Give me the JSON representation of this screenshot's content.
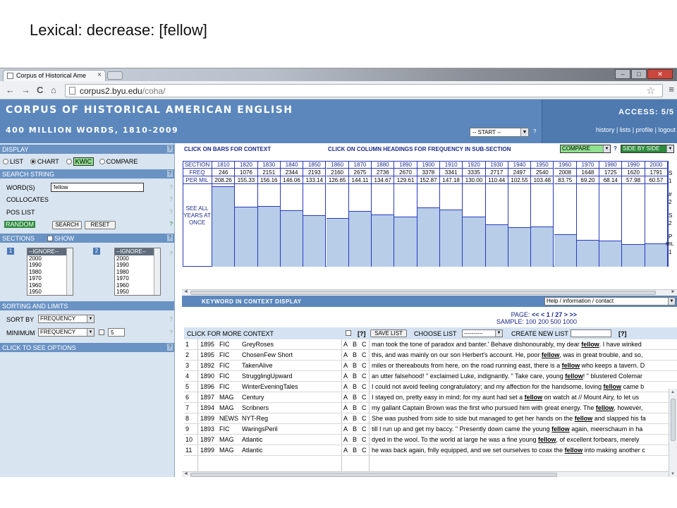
{
  "slide": {
    "title": "Lexical: decrease: [fellow]"
  },
  "browser": {
    "tab_title": "Corpus of Historical Ame",
    "tab_close": "×",
    "url_host": "corpus2.byu.edu",
    "url_path": "/coha/",
    "back": "←",
    "forward": "→",
    "reload": "C",
    "home": "⌂",
    "star": "☆",
    "menu": "≡",
    "min": "–",
    "max": "□",
    "close": "✕"
  },
  "header": {
    "title": "CORPUS OF HISTORICAL AMERICAN ENGLISH",
    "subtitle": "400 MILLION WORDS, 1810-2009",
    "start_select": "-- START --",
    "start_help": "?",
    "access": "ACCESS:  5/5",
    "links": "history  |  lists  |  profile  |  logout"
  },
  "left": {
    "display_head": "DISPLAY",
    "display_options": {
      "list": "LIST",
      "chart": "CHART",
      "kwic": "KWIC",
      "compare": "COMPARE"
    },
    "search_head": "SEARCH STRING",
    "words_label": "WORD(S)",
    "words_value": "fellow",
    "collocates_label": "COLLOCATES",
    "poslist_label": "POS LIST",
    "random_label": "RANDOM",
    "search_btn": "SEARCH",
    "reset_btn": "RESET",
    "sections_head": "SECTIONS",
    "show_label": "SHOW",
    "sec1_num": "1",
    "sec2_num": "2",
    "sec1_options": [
      "--IGNORE--",
      "2000",
      "1990",
      "1980",
      "1970",
      "1960",
      "1950"
    ],
    "sec2_options": [
      "--IGNORE--",
      "2000",
      "1990",
      "1980",
      "1970",
      "1960",
      "1950"
    ],
    "sorting_head": "SORTING AND LIMITS",
    "sort_by_label": "SORT BY",
    "sort_by_value": "FREQUENCY",
    "minimum_label": "MINIMUM",
    "minimum_value": "FREQUENCY",
    "minimum_num": "5",
    "options_head": "CLICK TO SEE OPTIONS",
    "q": "?"
  },
  "chart": {
    "click_bars": "CLICK ON BARS FOR CONTEXT",
    "click_cols": "CLICK ON COLUMN HEADINGS FOR FREQUENCY IN SUB-SECTION",
    "compare_select": "COMPARE",
    "help": "?",
    "side_select": "SIDE BY SIDE",
    "section_label": "SECTION",
    "freq_label": "FREQ",
    "permil_label": "PER MIL",
    "see_all": "SEE ALL YEARS AT ONCE",
    "side_letters": [
      "S",
      "1",
      "#",
      "2",
      "S",
      "2",
      "P",
      "MIL",
      "1"
    ]
  },
  "chart_data": {
    "type": "bar",
    "categories": [
      "1810",
      "1820",
      "1830",
      "1840",
      "1850",
      "1860",
      "1870",
      "1880",
      "1890",
      "1900",
      "1910",
      "1920",
      "1930",
      "1940",
      "1950",
      "1960",
      "1970",
      "1980",
      "1990",
      "2000"
    ],
    "freq": [
      246,
      1076,
      2151,
      2344,
      2193,
      2160,
      2675,
      2736,
      2670,
      3378,
      3341,
      3335,
      2717,
      2497,
      2540,
      2008,
      1648,
      1725,
      1620,
      1791
    ],
    "values": [
      208.26,
      155.33,
      156.16,
      146.06,
      133.14,
      126.65,
      144.11,
      134.67,
      129.61,
      152.87,
      147.18,
      130.0,
      110.44,
      102.55,
      103.48,
      83.75,
      69.2,
      68.14,
      57.98,
      60.57
    ],
    "values_display": [
      "208.26",
      "155.33",
      "156.16",
      "146.06",
      "133.14",
      "126.65",
      "144.11",
      "134.67",
      "129.61",
      "152.87",
      "147.18",
      "130.00",
      "110.44",
      "102.55",
      "103.48",
      "83.75",
      "69.20",
      "68.14",
      "57.98",
      "60.57"
    ],
    "ylabel": "PER MIL"
  },
  "kwic": {
    "title": "KEYWORD IN CONTEXT DISPLAY",
    "help_select": "Help / information / contact",
    "page_label": "PAGE:",
    "page_nav": "<<  <   1 / 27  >   >>",
    "sample_label": "SAMPLE: 100  200  500  1000",
    "more_context": "CLICK FOR MORE CONTEXT",
    "q": "[?]",
    "save_list": "SAVE LIST",
    "choose_list": "CHOOSE LIST",
    "choose_value": "----------",
    "create_list": "CREATE NEW LIST",
    "q2": "[?]",
    "rows": [
      {
        "n": "1",
        "year": "1895",
        "genre": "FIC",
        "source": "GreyRoses",
        "a": "A",
        "b": "B",
        "c": "C",
        "pre": "man took the tone of paradox and banter.' Behave dishonourably, my dear ",
        "kw": "fellow",
        "post": ". I have winked"
      },
      {
        "n": "2",
        "year": "1895",
        "genre": "FIC",
        "source": "ChosenFew Short",
        "a": "A",
        "b": "B",
        "c": "C",
        "pre": "this, and was mainly on our son Herbert's account. He, poor ",
        "kw": "fellow",
        "post": ", was in great trouble, and so,"
      },
      {
        "n": "3",
        "year": "1892",
        "genre": "FIC",
        "source": "TakenAlive",
        "a": "A",
        "b": "B",
        "c": "C",
        "pre": "miles or thereabouts from here, on the road running east, there is a ",
        "kw": "fellow",
        "post": " who keeps a tavern. D"
      },
      {
        "n": "4",
        "year": "1890",
        "genre": "FIC",
        "source": "StrugglingUpward",
        "a": "A",
        "b": "B",
        "c": "C",
        "pre": "an utter falsehood! \" exclaimed Luke, indignantly. \" Take care, young ",
        "kw": "fellow",
        "post": "! \" blustered Colemar"
      },
      {
        "n": "5",
        "year": "1896",
        "genre": "FIC",
        "source": "WinterEveningTales",
        "a": "A",
        "b": "B",
        "c": "C",
        "pre": "I could not avoid feeling congratulatory; and my affection for the handsome, loving ",
        "kw": "fellow",
        "post": " came b"
      },
      {
        "n": "6",
        "year": "1897",
        "genre": "MAG",
        "source": "Century",
        "a": "A",
        "b": "B",
        "c": "C",
        "pre": "I stayed on, pretty easy in mind; for my aunt had set a ",
        "kw": "fellow",
        "post": " on watch at // Mount Airy, to let us"
      },
      {
        "n": "7",
        "year": "1894",
        "genre": "MAG",
        "source": "Scribners",
        "a": "A",
        "b": "B",
        "c": "C",
        "pre": "my gallant Captain Brown was the first who pursued him with great energy. The ",
        "kw": "fellow",
        "post": ", however,"
      },
      {
        "n": "8",
        "year": "1899",
        "genre": "NEWS",
        "source": "NYT-Reg",
        "a": "A",
        "b": "B",
        "c": "C",
        "pre": "She was pushed from side to side but managed to get her hands on the ",
        "kw": "fellow",
        "post": " and slapped his fa"
      },
      {
        "n": "9",
        "year": "1893",
        "genre": "FIC",
        "source": "WaringsPeril",
        "a": "A",
        "b": "B",
        "c": "C",
        "pre": "till I run up and get my baccy. \" Presently down came the young ",
        "kw": "fellow",
        "post": " again, meerschaum in ha"
      },
      {
        "n": "10",
        "year": "1897",
        "genre": "MAG",
        "source": "Atlantic",
        "a": "A",
        "b": "B",
        "c": "C",
        "pre": "dyed in the wool. To the world at large he was a fine young ",
        "kw": "fellow",
        "post": ", of excellent forbears, merely"
      },
      {
        "n": "11",
        "year": "1899",
        "genre": "MAG",
        "source": "Atlantic",
        "a": "A",
        "b": "B",
        "c": "C",
        "pre": "he was back again, fnlly equipped, and we set ourselves to coax the ",
        "kw": "fellow",
        "post": " into making another c"
      }
    ]
  },
  "colors": {
    "header_blue": "#5b87bc",
    "grid_blue": "#2a3ac0",
    "bar_fill": "#b7cde8",
    "kwic_green": "#8fe08f",
    "random_green": "#2c8a3c"
  }
}
